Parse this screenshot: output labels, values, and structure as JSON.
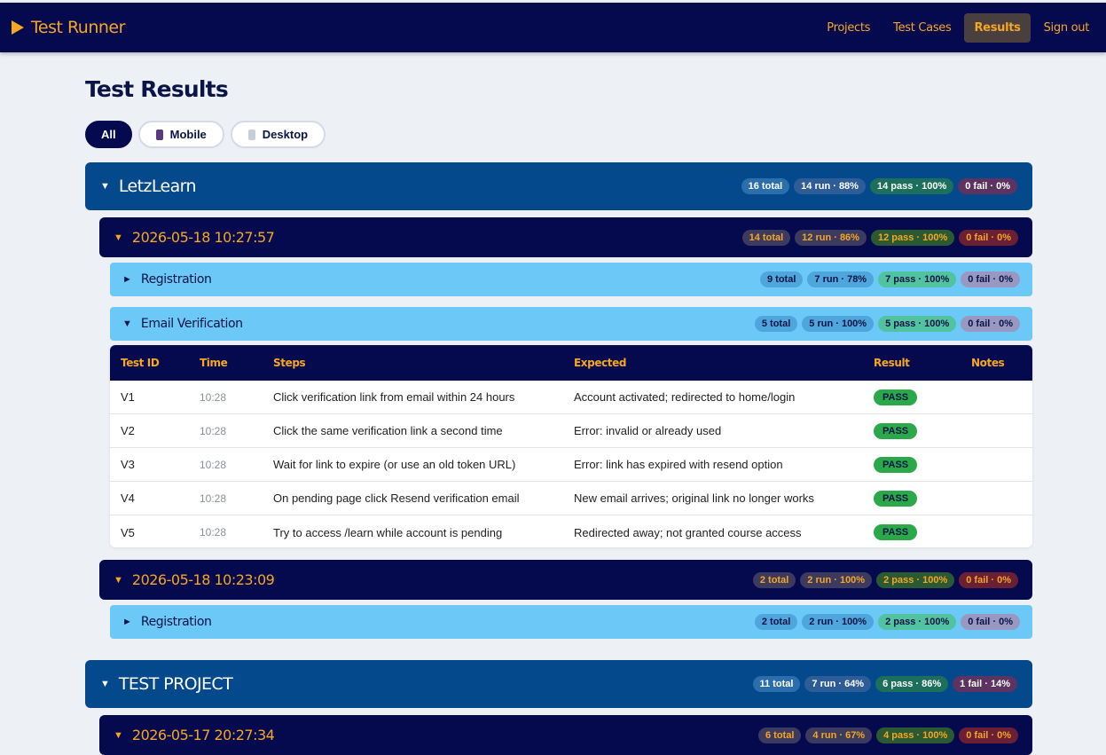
{
  "app": {
    "brand": "Test Runner"
  },
  "nav": {
    "items": [
      {
        "label": "Projects",
        "active": false
      },
      {
        "label": "Test Cases",
        "active": false
      },
      {
        "label": "Results",
        "active": true
      },
      {
        "label": "Sign out",
        "active": false
      }
    ]
  },
  "page": {
    "title": "Test Results"
  },
  "filters": [
    {
      "label": "All",
      "active": true
    },
    {
      "label": "Mobile",
      "icon": "mobile-phone-icon"
    },
    {
      "label": "Desktop",
      "icon": "desktop-device-icon"
    }
  ],
  "projects": [
    {
      "name": "LetzLearn",
      "badges": [
        "16 total",
        "14 run · 88%",
        "14 pass · 100%",
        "0 fail · 0%"
      ],
      "runs": [
        {
          "timestamp": "2026-05-18 10:27:57",
          "badges": [
            "14 total",
            "12 run · 86%",
            "12 pass · 100%",
            "0 fail · 0%"
          ],
          "suites": [
            {
              "name": "Registration",
              "expanded": false,
              "badges": [
                "9 total",
                "7 run · 78%",
                "7 pass · 100%",
                "0 fail · 0%"
              ]
            },
            {
              "name": "Email Verification",
              "expanded": true,
              "badges": [
                "5 total",
                "5 run · 100%",
                "5 pass · 100%",
                "0 fail · 0%"
              ]
            }
          ]
        },
        {
          "timestamp": "2026-05-18 10:23:09",
          "badges": [
            "2 total",
            "2 run · 100%",
            "2 pass · 100%",
            "0 fail · 0%"
          ],
          "suites": [
            {
              "name": "Registration",
              "expanded": false,
              "badges": [
                "2 total",
                "2 run · 100%",
                "2 pass · 100%",
                "0 fail · 0%"
              ]
            }
          ]
        }
      ]
    },
    {
      "name": "TEST PROJECT",
      "badges": [
        "11 total",
        "7 run · 64%",
        "6 pass · 86%",
        "1 fail · 14%"
      ],
      "runs": [
        {
          "timestamp": "2026-05-17 20:27:34",
          "badges": [
            "6 total",
            "4 run · 67%",
            "4 pass · 100%",
            "0 fail · 0%"
          ]
        }
      ]
    }
  ],
  "table": {
    "headers": [
      "Test ID",
      "Time",
      "Steps",
      "Expected",
      "Result",
      "Notes"
    ],
    "rows": [
      {
        "id": "V1",
        "time": "10:28",
        "steps": "Click verification link from email within 24 hours",
        "expected": "Account activated; redirected to home/login",
        "result": "PASS",
        "notes": ""
      },
      {
        "id": "V2",
        "time": "10:28",
        "steps": "Click the same verification link a second time",
        "expected": "Error: invalid or already used",
        "result": "PASS",
        "notes": ""
      },
      {
        "id": "V3",
        "time": "10:28",
        "steps": "Wait for link to expire (or use an old token URL)",
        "expected": "Error: link has expired with resend option",
        "result": "PASS",
        "notes": ""
      },
      {
        "id": "V4",
        "time": "10:28",
        "steps": "On pending page click Resend verification email",
        "expected": "New email arrives; original link no longer works",
        "result": "PASS",
        "notes": ""
      },
      {
        "id": "V5",
        "time": "10:28",
        "steps": "Try to access /learn while account is pending",
        "expected": "Redirected away; not granted course access",
        "result": "PASS",
        "notes": ""
      }
    ]
  },
  "colors": {
    "navy": "#05094d",
    "accent": "#f5a623",
    "project": "#03498c",
    "suite": "#6cc8f7",
    "pass": "#2aa84a"
  }
}
